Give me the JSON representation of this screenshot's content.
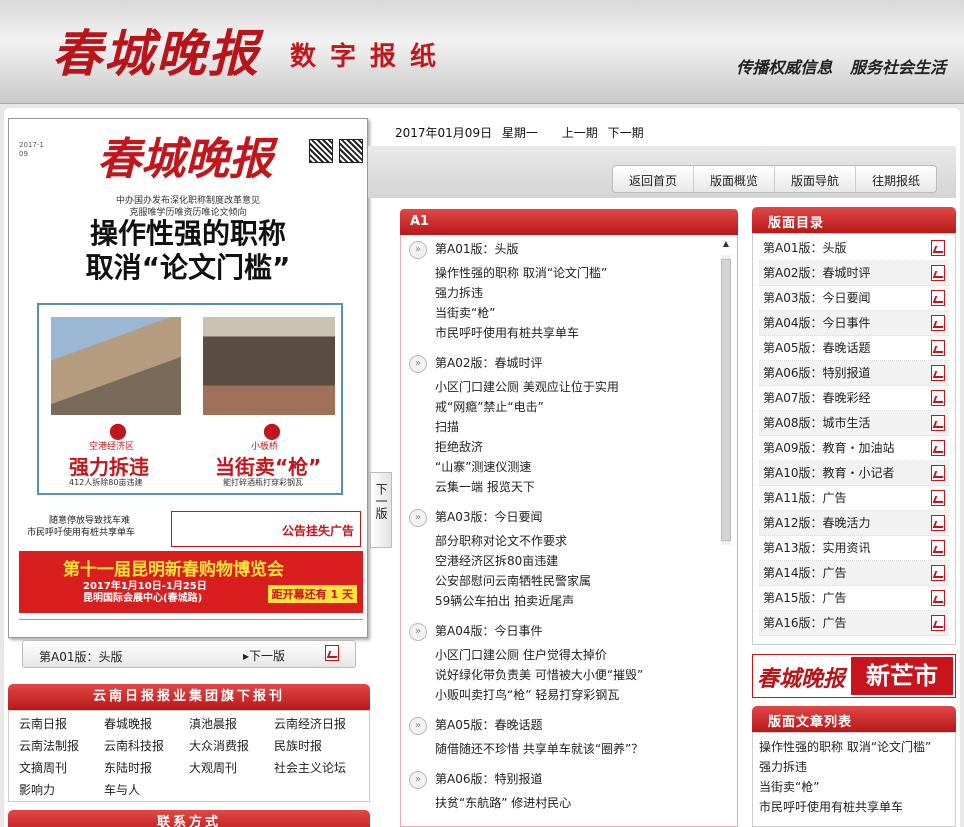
{
  "header": {
    "logo": "春城晚报",
    "subtitle": "数字报纸",
    "slogan": "传播权威信息 服务社会生活"
  },
  "paper": {
    "logo": "春城晚报",
    "date_small": "2017-1\n09",
    "kicker1": "中办国办发布深化职称制度改革意见",
    "kicker2": "克服唯学历唯资历唯论文倾向",
    "headline1": "操作性强的职称",
    "headline2": "取消“论文门槛”",
    "left_place": "空港经济区",
    "left_big": "强力拆违",
    "left_small": "412人拆除80亩违建",
    "right_place": "小板桥",
    "right_big": "当街卖“枪”",
    "right_small": "能打碎酒瓶打穿彩钢瓦",
    "bottom_line1": "随意停放导致找车难",
    "bottom_line2": "市民呼吁使用有桩共享单车",
    "ad_small": "公告挂失广告",
    "ad_title": "第十一届昆明新春购物博览会",
    "ad_date": "2017年1月10日-1月25日",
    "ad_place": "昆明国际会展中心(春城路)",
    "ad_count": "距开幕还有 1 天"
  },
  "pager": {
    "current": "第A01版：头版",
    "next": "▸下一版"
  },
  "side_tab": "下一版",
  "date_bar": {
    "date": "2017年01月09日",
    "weekday": "星期一",
    "prev": "上一期",
    "next": "下一期"
  },
  "nav": [
    "返回首页",
    "版面概览",
    "版面导航",
    "往期报纸"
  ],
  "middle": {
    "head": "A1",
    "sections": [
      {
        "title": "第A01版：头版",
        "articles": [
          "操作性强的职称 取消“论文门槛”",
          "强力拆违",
          "当街卖“枪”",
          "市民呼吁使用有桩共享单车"
        ]
      },
      {
        "title": "第A02版：春城时评",
        "articles": [
          "小区门口建公厕 美观应让位于实用",
          "戒“网瘾”禁止“电击”",
          "扫描",
          "拒绝敌济",
          "“山寨”测速仪测速",
          "云集一端 报览天下"
        ]
      },
      {
        "title": "第A03版：今日要闻",
        "articles": [
          "部分职称对论文不作要求",
          "空港经济区拆80亩违建",
          "公安部慰问云南牺牲民警家属",
          "59辆公车拍出 拍卖近尾声"
        ]
      },
      {
        "title": "第A04版：今日事件",
        "articles": [
          "小区门口建公厕 住户觉得太掉价",
          "说好绿化带负责美 可惜被大小便“摧毁”",
          "小贩叫卖打鸟“枪” 轻易打穿彩钢瓦"
        ]
      },
      {
        "title": "第A05版：春晚话题",
        "articles": [
          "随借随还不珍惜 共享单车就该“圈养”？"
        ]
      },
      {
        "title": "第A06版：特别报道",
        "articles": [
          "扶贫“东航路” 修进村民心"
        ]
      }
    ]
  },
  "toc": {
    "head": "版面目录",
    "items": [
      "第A01版：头版",
      "第A02版：春城时评",
      "第A03版：今日要闻",
      "第A04版：今日事件",
      "第A05版：春晚话题",
      "第A06版：特别报道",
      "第A07版：春晚彩经",
      "第A08版：城市生活",
      "第A09版：教育・加油站",
      "第A10版：教育・小记者",
      "第A11版：广告",
      "第A12版：春晚活力",
      "第A13版：实用资讯",
      "第A14版：广告",
      "第A15版：广告",
      "第A16版：广告"
    ]
  },
  "banner_ad": {
    "left": "春城晚报",
    "right": "新芒市"
  },
  "article_list": {
    "head": "版面文章列表",
    "items": [
      "操作性强的职称 取消“论文门槛”",
      "强力拆违",
      "当街卖“枪”",
      "市民呼吁使用有桩共享单车"
    ]
  },
  "group": {
    "head": "云南日报报业集团旗下报刊",
    "links": [
      "云南日报",
      "春城晚报",
      "滇池晨报",
      "云南经济日报",
      "云南法制报",
      "云南科技报",
      "大众消费报",
      "民族时报",
      "文摘周刊",
      "东陆时报",
      "大观周刊",
      "社会主义论坛",
      "影响力",
      "车与人"
    ]
  },
  "contact_head": "联系方式"
}
